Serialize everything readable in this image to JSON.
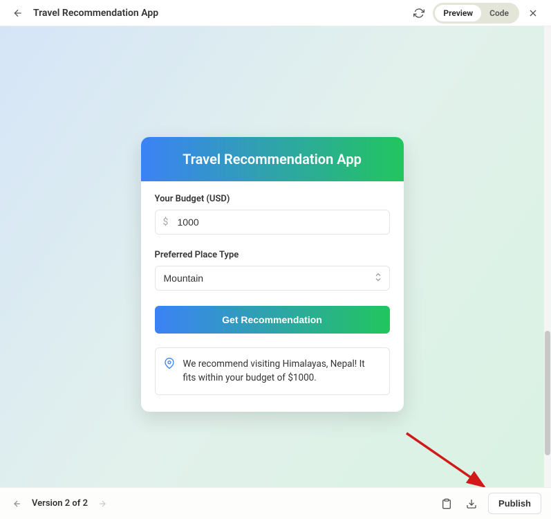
{
  "topbar": {
    "title": "Travel Recommendation App",
    "preview_label": "Preview",
    "code_label": "Code"
  },
  "card": {
    "title": "Travel Recommendation App",
    "budget_label": "Your Budget (USD)",
    "budget_value": "1000",
    "budget_prefix": "$",
    "place_label": "Preferred Place Type",
    "place_value": "Mountain",
    "submit_label": "Get Recommendation",
    "result_text": "We recommend visiting Himalayas, Nepal! It fits within your budget of $1000."
  },
  "bottombar": {
    "version_label": "Version 2 of 2",
    "publish_label": "Publish"
  }
}
